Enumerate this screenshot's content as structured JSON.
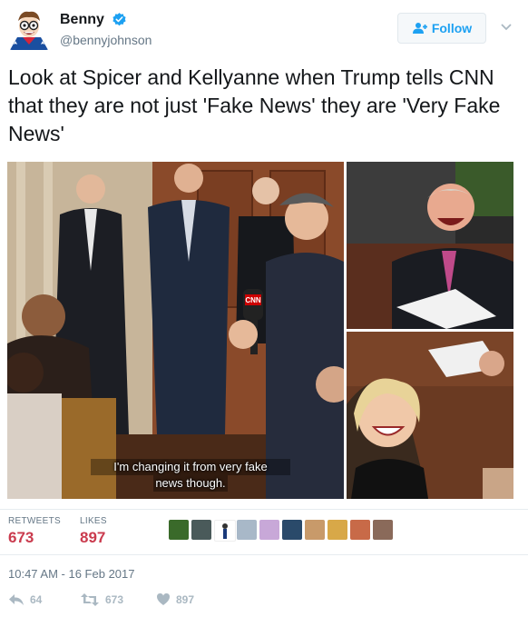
{
  "user": {
    "display_name": "Benny",
    "handle": "@bennyjohnson",
    "verified": true
  },
  "follow_button": {
    "label": "Follow"
  },
  "tweet": {
    "text": "Look at Spicer and Kellyanne when Trump tells CNN that they are not just 'Fake News' they are 'Very Fake News'"
  },
  "media": {
    "caption_line1": "I'm changing it from very fake",
    "caption_line2": "news though.",
    "mic_logo": "CNN"
  },
  "stats": {
    "retweets_label": "RETWEETS",
    "retweets_value": "673",
    "likes_label": "LIKES",
    "likes_value": "897"
  },
  "timestamp": "10:47 AM - 16 Feb 2017",
  "actions": {
    "reply_count": "64",
    "retweet_count": "673",
    "like_count": "897"
  },
  "colors": {
    "accent": "#1da1f2",
    "stat_number": "#ca3b4e",
    "muted": "#657786",
    "action_icon": "#aab8c2"
  }
}
